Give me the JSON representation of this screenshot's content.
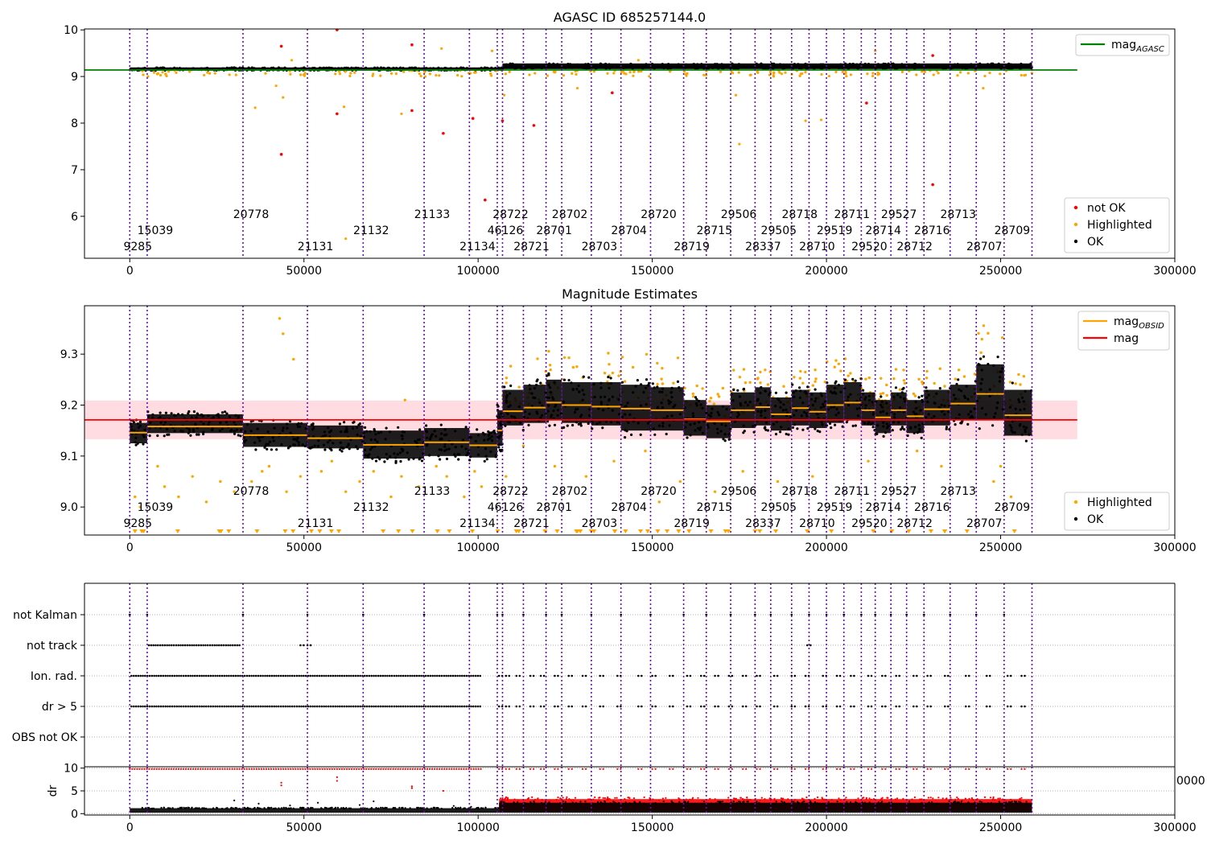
{
  "chart_data": [
    {
      "type": "scatter",
      "title": "AGASC ID 685257144.0",
      "xlim": [
        -13000,
        300000
      ],
      "ylim": [
        5.1,
        10.02
      ],
      "xticks": [
        0,
        50000,
        100000,
        150000,
        200000,
        250000,
        300000
      ],
      "yticks": [
        6,
        7,
        8,
        9,
        10
      ],
      "reference_line": {
        "label": "mag_AGASC",
        "value": 9.14,
        "x_range": [
          -13000,
          272000
        ],
        "color": "#008000"
      },
      "series": [
        {
          "name": "not OK",
          "color": "#ff0000",
          "points": [
            [
              43500,
              9.65
            ],
            [
              59500,
              10.0
            ],
            [
              59500,
              8.2
            ],
            [
              81000,
              9.68
            ],
            [
              81000,
              8.27
            ],
            [
              90000,
              7.78
            ],
            [
              98500,
              8.1
            ],
            [
              102000,
              6.35
            ],
            [
              107000,
              8.05
            ],
            [
              116000,
              7.95
            ],
            [
              138500,
              8.65
            ],
            [
              211500,
              8.43
            ],
            [
              230500,
              9.45
            ],
            [
              230500,
              6.68
            ],
            [
              43500,
              7.33
            ]
          ]
        },
        {
          "name": "Highlighted",
          "color": "#ffa500",
          "points": [
            [
              36000,
              8.33
            ],
            [
              42000,
              8.8
            ],
            [
              44000,
              8.55
            ],
            [
              46500,
              9.35
            ],
            [
              61500,
              8.35
            ],
            [
              62000,
              5.52
            ],
            [
              78000,
              8.2
            ],
            [
              89500,
              9.6
            ],
            [
              104000,
              9.55
            ],
            [
              107500,
              8.6
            ],
            [
              128500,
              8.75
            ],
            [
              146000,
              9.35
            ],
            [
              174000,
              8.6
            ],
            [
              175000,
              7.55
            ],
            [
              194000,
              8.05
            ],
            [
              198500,
              8.07
            ],
            [
              214000,
              9.55
            ],
            [
              245000,
              8.75
            ]
          ]
        },
        {
          "name": "OK",
          "color": "#000000",
          "segments": [
            [
              0,
              107000,
              9.16
            ],
            [
              107000,
              259000,
              9.22
            ]
          ]
        }
      ],
      "legend": {
        "entries": [
          "not OK",
          "Highlighted",
          "OK"
        ],
        "placement": "lower-right"
      },
      "legend_lines": {
        "entries": [
          "mag_AGASC"
        ],
        "placement": "upper-right"
      }
    },
    {
      "type": "scatter",
      "title": "Magnitude Estimates",
      "xlim": [
        -13000,
        300000
      ],
      "ylim": [
        8.945,
        9.395
      ],
      "xticks": [
        0,
        50000,
        100000,
        150000,
        200000,
        250000,
        300000
      ],
      "yticks": [
        9.0,
        9.1,
        9.2,
        9.3
      ],
      "mag": {
        "label": "mag",
        "value": 9.171,
        "band": [
          9.133,
          9.209
        ],
        "color": "#ff0000",
        "x_range": [
          -13000,
          272000
        ]
      },
      "mag_obsid_label": "mag_OBSID",
      "obs_means": [
        {
          "x0": 0,
          "x1": 5000,
          "mean": 9.146,
          "lo": 9.125,
          "hi": 9.165
        },
        {
          "x0": 5000,
          "x1": 32500,
          "mean": 9.158,
          "lo": 9.145,
          "hi": 9.182
        },
        {
          "x0": 32500,
          "x1": 51000,
          "mean": 9.141,
          "lo": 9.118,
          "hi": 9.165
        },
        {
          "x0": 51000,
          "x1": 67000,
          "mean": 9.135,
          "lo": 9.115,
          "hi": 9.16
        },
        {
          "x0": 67000,
          "x1": 84500,
          "mean": 9.122,
          "lo": 9.095,
          "hi": 9.15
        },
        {
          "x0": 84500,
          "x1": 97500,
          "mean": 9.127,
          "lo": 9.1,
          "hi": 9.155
        },
        {
          "x0": 97500,
          "x1": 105500,
          "mean": 9.121,
          "lo": 9.097,
          "hi": 9.145
        },
        {
          "x0": 105500,
          "x1": 107000,
          "mean": 9.15,
          "lo": 9.12,
          "hi": 9.19
        },
        {
          "x0": 107000,
          "x1": 113000,
          "mean": 9.188,
          "lo": 9.16,
          "hi": 9.23
        },
        {
          "x0": 113000,
          "x1": 119500,
          "mean": 9.195,
          "lo": 9.165,
          "hi": 9.24
        },
        {
          "x0": 119500,
          "x1": 124000,
          "mean": 9.205,
          "lo": 9.17,
          "hi": 9.25
        },
        {
          "x0": 124000,
          "x1": 132500,
          "mean": 9.2,
          "lo": 9.165,
          "hi": 9.245
        },
        {
          "x0": 132500,
          "x1": 141000,
          "mean": 9.197,
          "lo": 9.16,
          "hi": 9.245
        },
        {
          "x0": 141000,
          "x1": 149500,
          "mean": 9.193,
          "lo": 9.15,
          "hi": 9.24
        },
        {
          "x0": 149500,
          "x1": 159000,
          "mean": 9.19,
          "lo": 9.15,
          "hi": 9.235
        },
        {
          "x0": 159000,
          "x1": 165500,
          "mean": 9.172,
          "lo": 9.14,
          "hi": 9.21
        },
        {
          "x0": 165500,
          "x1": 172500,
          "mean": 9.168,
          "lo": 9.135,
          "hi": 9.2
        },
        {
          "x0": 172500,
          "x1": 179500,
          "mean": 9.19,
          "lo": 9.155,
          "hi": 9.225
        },
        {
          "x0": 179500,
          "x1": 184000,
          "mean": 9.196,
          "lo": 9.16,
          "hi": 9.235
        },
        {
          "x0": 184000,
          "x1": 190000,
          "mean": 9.182,
          "lo": 9.15,
          "hi": 9.215
        },
        {
          "x0": 190000,
          "x1": 195000,
          "mean": 9.194,
          "lo": 9.16,
          "hi": 9.23
        },
        {
          "x0": 195000,
          "x1": 200000,
          "mean": 9.187,
          "lo": 9.155,
          "hi": 9.225
        },
        {
          "x0": 200000,
          "x1": 205000,
          "mean": 9.2,
          "lo": 9.165,
          "hi": 9.24
        },
        {
          "x0": 205000,
          "x1": 210000,
          "mean": 9.205,
          "lo": 9.17,
          "hi": 9.245
        },
        {
          "x0": 210000,
          "x1": 214000,
          "mean": 9.19,
          "lo": 9.16,
          "hi": 9.225
        },
        {
          "x0": 214000,
          "x1": 218500,
          "mean": 9.176,
          "lo": 9.145,
          "hi": 9.21
        },
        {
          "x0": 218500,
          "x1": 223000,
          "mean": 9.19,
          "lo": 9.16,
          "hi": 9.225
        },
        {
          "x0": 223000,
          "x1": 228000,
          "mean": 9.178,
          "lo": 9.145,
          "hi": 9.21
        },
        {
          "x0": 228000,
          "x1": 235500,
          "mean": 9.192,
          "lo": 9.16,
          "hi": 9.23
        },
        {
          "x0": 235500,
          "x1": 243000,
          "mean": 9.203,
          "lo": 9.17,
          "hi": 9.24
        },
        {
          "x0": 243000,
          "x1": 251000,
          "mean": 9.222,
          "lo": 9.17,
          "hi": 9.28
        },
        {
          "x0": 251000,
          "x1": 259000,
          "mean": 9.18,
          "lo": 9.14,
          "hi": 9.23
        }
      ],
      "highlighted_points": [
        [
          1500,
          9.02
        ],
        [
          3000,
          9.0
        ],
        [
          8000,
          9.08
        ],
        [
          10000,
          9.04
        ],
        [
          14000,
          9.02
        ],
        [
          18000,
          9.06
        ],
        [
          22000,
          9.01
        ],
        [
          26000,
          9.05
        ],
        [
          30000,
          9.03
        ],
        [
          35000,
          9.05
        ],
        [
          38000,
          9.07
        ],
        [
          40000,
          9.08
        ],
        [
          43000,
          9.37
        ],
        [
          44000,
          9.34
        ],
        [
          45000,
          9.03
        ],
        [
          47000,
          9.29
        ],
        [
          49000,
          9.06
        ],
        [
          55000,
          9.07
        ],
        [
          58000,
          9.09
        ],
        [
          62000,
          9.03
        ],
        [
          66000,
          9.05
        ],
        [
          70000,
          9.07
        ],
        [
          75000,
          9.02
        ],
        [
          78000,
          9.06
        ],
        [
          79000,
          9.21
        ],
        [
          83000,
          9.04
        ],
        [
          88000,
          9.08
        ],
        [
          91000,
          9.06
        ],
        [
          96000,
          9.02
        ],
        [
          99000,
          9.07
        ],
        [
          101000,
          9.04
        ],
        [
          108000,
          9.06
        ],
        [
          113000,
          9.12
        ],
        [
          122000,
          9.08
        ],
        [
          131000,
          9.06
        ],
        [
          139000,
          9.09
        ],
        [
          148000,
          9.11
        ],
        [
          152000,
          9.01
        ],
        [
          158000,
          9.05
        ],
        [
          168000,
          9.03
        ],
        [
          176000,
          9.07
        ],
        [
          186000,
          9.05
        ],
        [
          196000,
          9.06
        ],
        [
          212000,
          9.09
        ],
        [
          226000,
          9.11
        ],
        [
          233000,
          9.08
        ],
        [
          248000,
          9.05
        ],
        [
          250000,
          9.08
        ],
        [
          253000,
          9.02
        ]
      ],
      "legend": {
        "entries": [
          "Highlighted",
          "OK"
        ],
        "placement": "lower-right"
      },
      "legend_lines": {
        "entries": [
          "mag_OBSID",
          "mag"
        ],
        "placement": "upper-right"
      }
    },
    {
      "type": "scatter",
      "title": "",
      "xlim": [
        -13000,
        300000
      ],
      "categories": [
        "not Kalman",
        "not track",
        "Ion. rad.",
        "dr > 5",
        "OBS not OK"
      ],
      "flag_ranges": {
        "not Kalman": [],
        "not track": [
          [
            5500,
            32000
          ]
        ],
        "Ion. rad.": [
          [
            500,
            101000
          ]
        ],
        "dr > 5": [
          [
            500,
            101000
          ]
        ],
        "OBS not OK": []
      },
      "flag_sparse": {
        "not track": [
          49000,
          51000,
          194500
        ],
        "Ion. rad.": [
          106000,
          108000,
          111000,
          115000,
          118000,
          122000,
          126000,
          130000,
          135000,
          140000,
          146000,
          150000,
          155000,
          160000,
          164000,
          168000,
          172000,
          176000,
          180000,
          185000,
          190000,
          194000,
          199000,
          203000,
          207000,
          212000,
          216000,
          220000,
          225000,
          229000,
          234000,
          240000,
          246000,
          252000,
          256000
        ],
        "dr > 5": [
          106000,
          108000,
          111000,
          115000,
          118000,
          122000,
          126000,
          130000,
          135000,
          140000,
          146000,
          150000,
          155000,
          160000,
          164000,
          168000,
          172000,
          176000,
          180000,
          185000,
          190000,
          194000,
          199000,
          203000,
          207000,
          212000,
          216000,
          220000,
          225000,
          229000,
          234000,
          240000,
          246000,
          252000,
          256000
        ]
      }
    },
    {
      "type": "scatter",
      "ylabel": "dr",
      "xlim": [
        -13000,
        300000
      ],
      "ylim": [
        -0.3,
        10.3
      ],
      "xticks": [
        0,
        50000,
        100000,
        150000,
        200000,
        250000,
        300000
      ],
      "yticks": [
        0,
        5,
        10
      ],
      "partial_tick_label": "0000",
      "bands": [
        {
          "x0": 0,
          "x1": 106000,
          "lo": 0.2,
          "hi": 1.2,
          "color": "#000000"
        },
        {
          "x0": 106000,
          "x1": 259000,
          "lo": 0.5,
          "hi": 3.2,
          "color": "#ff0000"
        },
        {
          "x0": 106000,
          "x1": 259000,
          "lo": 0.2,
          "hi": 2.4,
          "color": "#000000"
        }
      ],
      "top_rows": [
        {
          "x0": 0,
          "x1": 101000,
          "y": 9.8,
          "color": "#ff0000"
        }
      ],
      "outliers": [
        [
          43500,
          6.8
        ],
        [
          43500,
          6.2
        ],
        [
          59500,
          8.0
        ],
        [
          59500,
          7.2
        ],
        [
          81000,
          6.0
        ],
        [
          81000,
          5.6
        ],
        [
          90000,
          5.0
        ],
        [
          30000,
          2.9
        ],
        [
          37000,
          2.2
        ],
        [
          46000,
          1.8
        ],
        [
          54000,
          2.4
        ],
        [
          66000,
          1.9
        ],
        [
          70000,
          2.7
        ],
        [
          93000,
          1.7
        ],
        [
          98000,
          1.5
        ]
      ]
    }
  ],
  "obsids": [
    {
      "id": "9285",
      "x": 0,
      "row": 3
    },
    {
      "id": "15039",
      "x": 5000,
      "row": 2
    },
    {
      "id": "20778",
      "x": 32500,
      "row": 1
    },
    {
      "id": "21131",
      "x": 51000,
      "row": 3
    },
    {
      "id": "21132",
      "x": 67000,
      "row": 2
    },
    {
      "id": "21133",
      "x": 84500,
      "row": 1
    },
    {
      "id": "21134",
      "x": 97500,
      "row": 3
    },
    {
      "id": "46126",
      "x": 105500,
      "row": 2
    },
    {
      "id": "28722",
      "x": 107000,
      "row": 1
    },
    {
      "id": "28721",
      "x": 113000,
      "row": 3
    },
    {
      "id": "28701",
      "x": 119500,
      "row": 2
    },
    {
      "id": "28702",
      "x": 124000,
      "row": 1
    },
    {
      "id": "28703",
      "x": 132500,
      "row": 3
    },
    {
      "id": "28704",
      "x": 141000,
      "row": 2
    },
    {
      "id": "28720",
      "x": 149500,
      "row": 1
    },
    {
      "id": "28719",
      "x": 159000,
      "row": 3
    },
    {
      "id": "28715",
      "x": 165500,
      "row": 2
    },
    {
      "id": "29506",
      "x": 172500,
      "row": 1
    },
    {
      "id": "28337",
      "x": 179500,
      "row": 3
    },
    {
      "id": "29505",
      "x": 184000,
      "row": 2
    },
    {
      "id": "28718",
      "x": 190000,
      "row": 1
    },
    {
      "id": "28710",
      "x": 195000,
      "row": 3
    },
    {
      "id": "29519",
      "x": 200000,
      "row": 2
    },
    {
      "id": "28711",
      "x": 205000,
      "row": 1
    },
    {
      "id": "29520",
      "x": 210000,
      "row": 3
    },
    {
      "id": "28714",
      "x": 214000,
      "row": 2
    },
    {
      "id": "29527",
      "x": 218500,
      "row": 1
    },
    {
      "id": "28712",
      "x": 223000,
      "row": 3
    },
    {
      "id": "28716",
      "x": 228000,
      "row": 2
    },
    {
      "id": "28713",
      "x": 235500,
      "row": 1
    },
    {
      "id": "28707",
      "x": 243000,
      "row": 3
    },
    {
      "id": "28709",
      "x": 251000,
      "row": 2
    }
  ],
  "obs_end": 259000,
  "colors": {
    "highlight": "#ffa500",
    "not_ok": "#ff0000",
    "ok": "#000000",
    "agasc": "#008000",
    "mag": "#ff0000",
    "obsline": "#6a0dad",
    "band": "#ffc0cb"
  }
}
